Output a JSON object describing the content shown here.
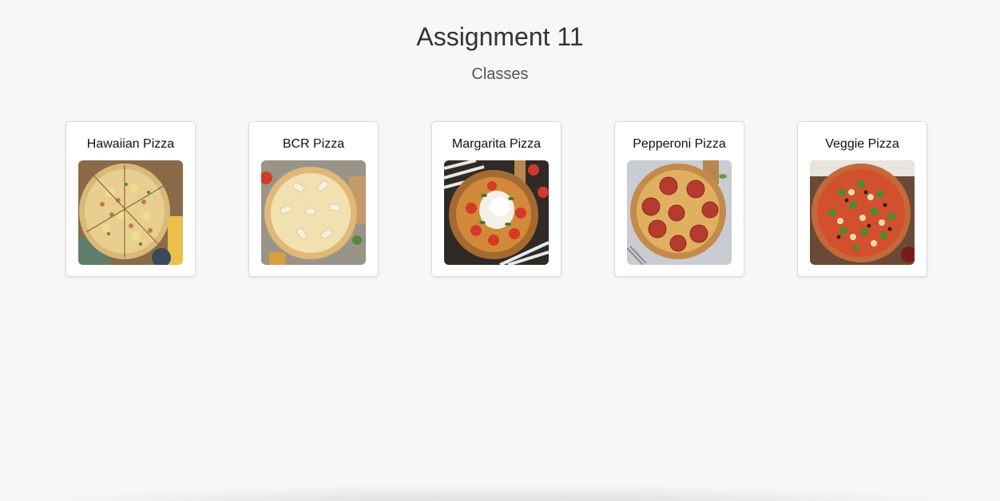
{
  "header": {
    "title": "Assignment 11",
    "subtitle": "Classes"
  },
  "pizzas": [
    {
      "name": "Hawaiian Pizza",
      "image_icon": "hawaiian-pizza-image"
    },
    {
      "name": "BCR Pizza",
      "image_icon": "bcr-pizza-image"
    },
    {
      "name": "Margarita Pizza",
      "image_icon": "margarita-pizza-image"
    },
    {
      "name": "Pepperoni Pizza",
      "image_icon": "pepperoni-pizza-image"
    },
    {
      "name": "Veggie Pizza",
      "image_icon": "veggie-pizza-image"
    }
  ],
  "colors": {
    "background": "#f7f7f7",
    "card_background": "#ffffff",
    "card_border": "#dcdcdc",
    "title_text": "#333333",
    "subtitle_text": "#555555"
  }
}
